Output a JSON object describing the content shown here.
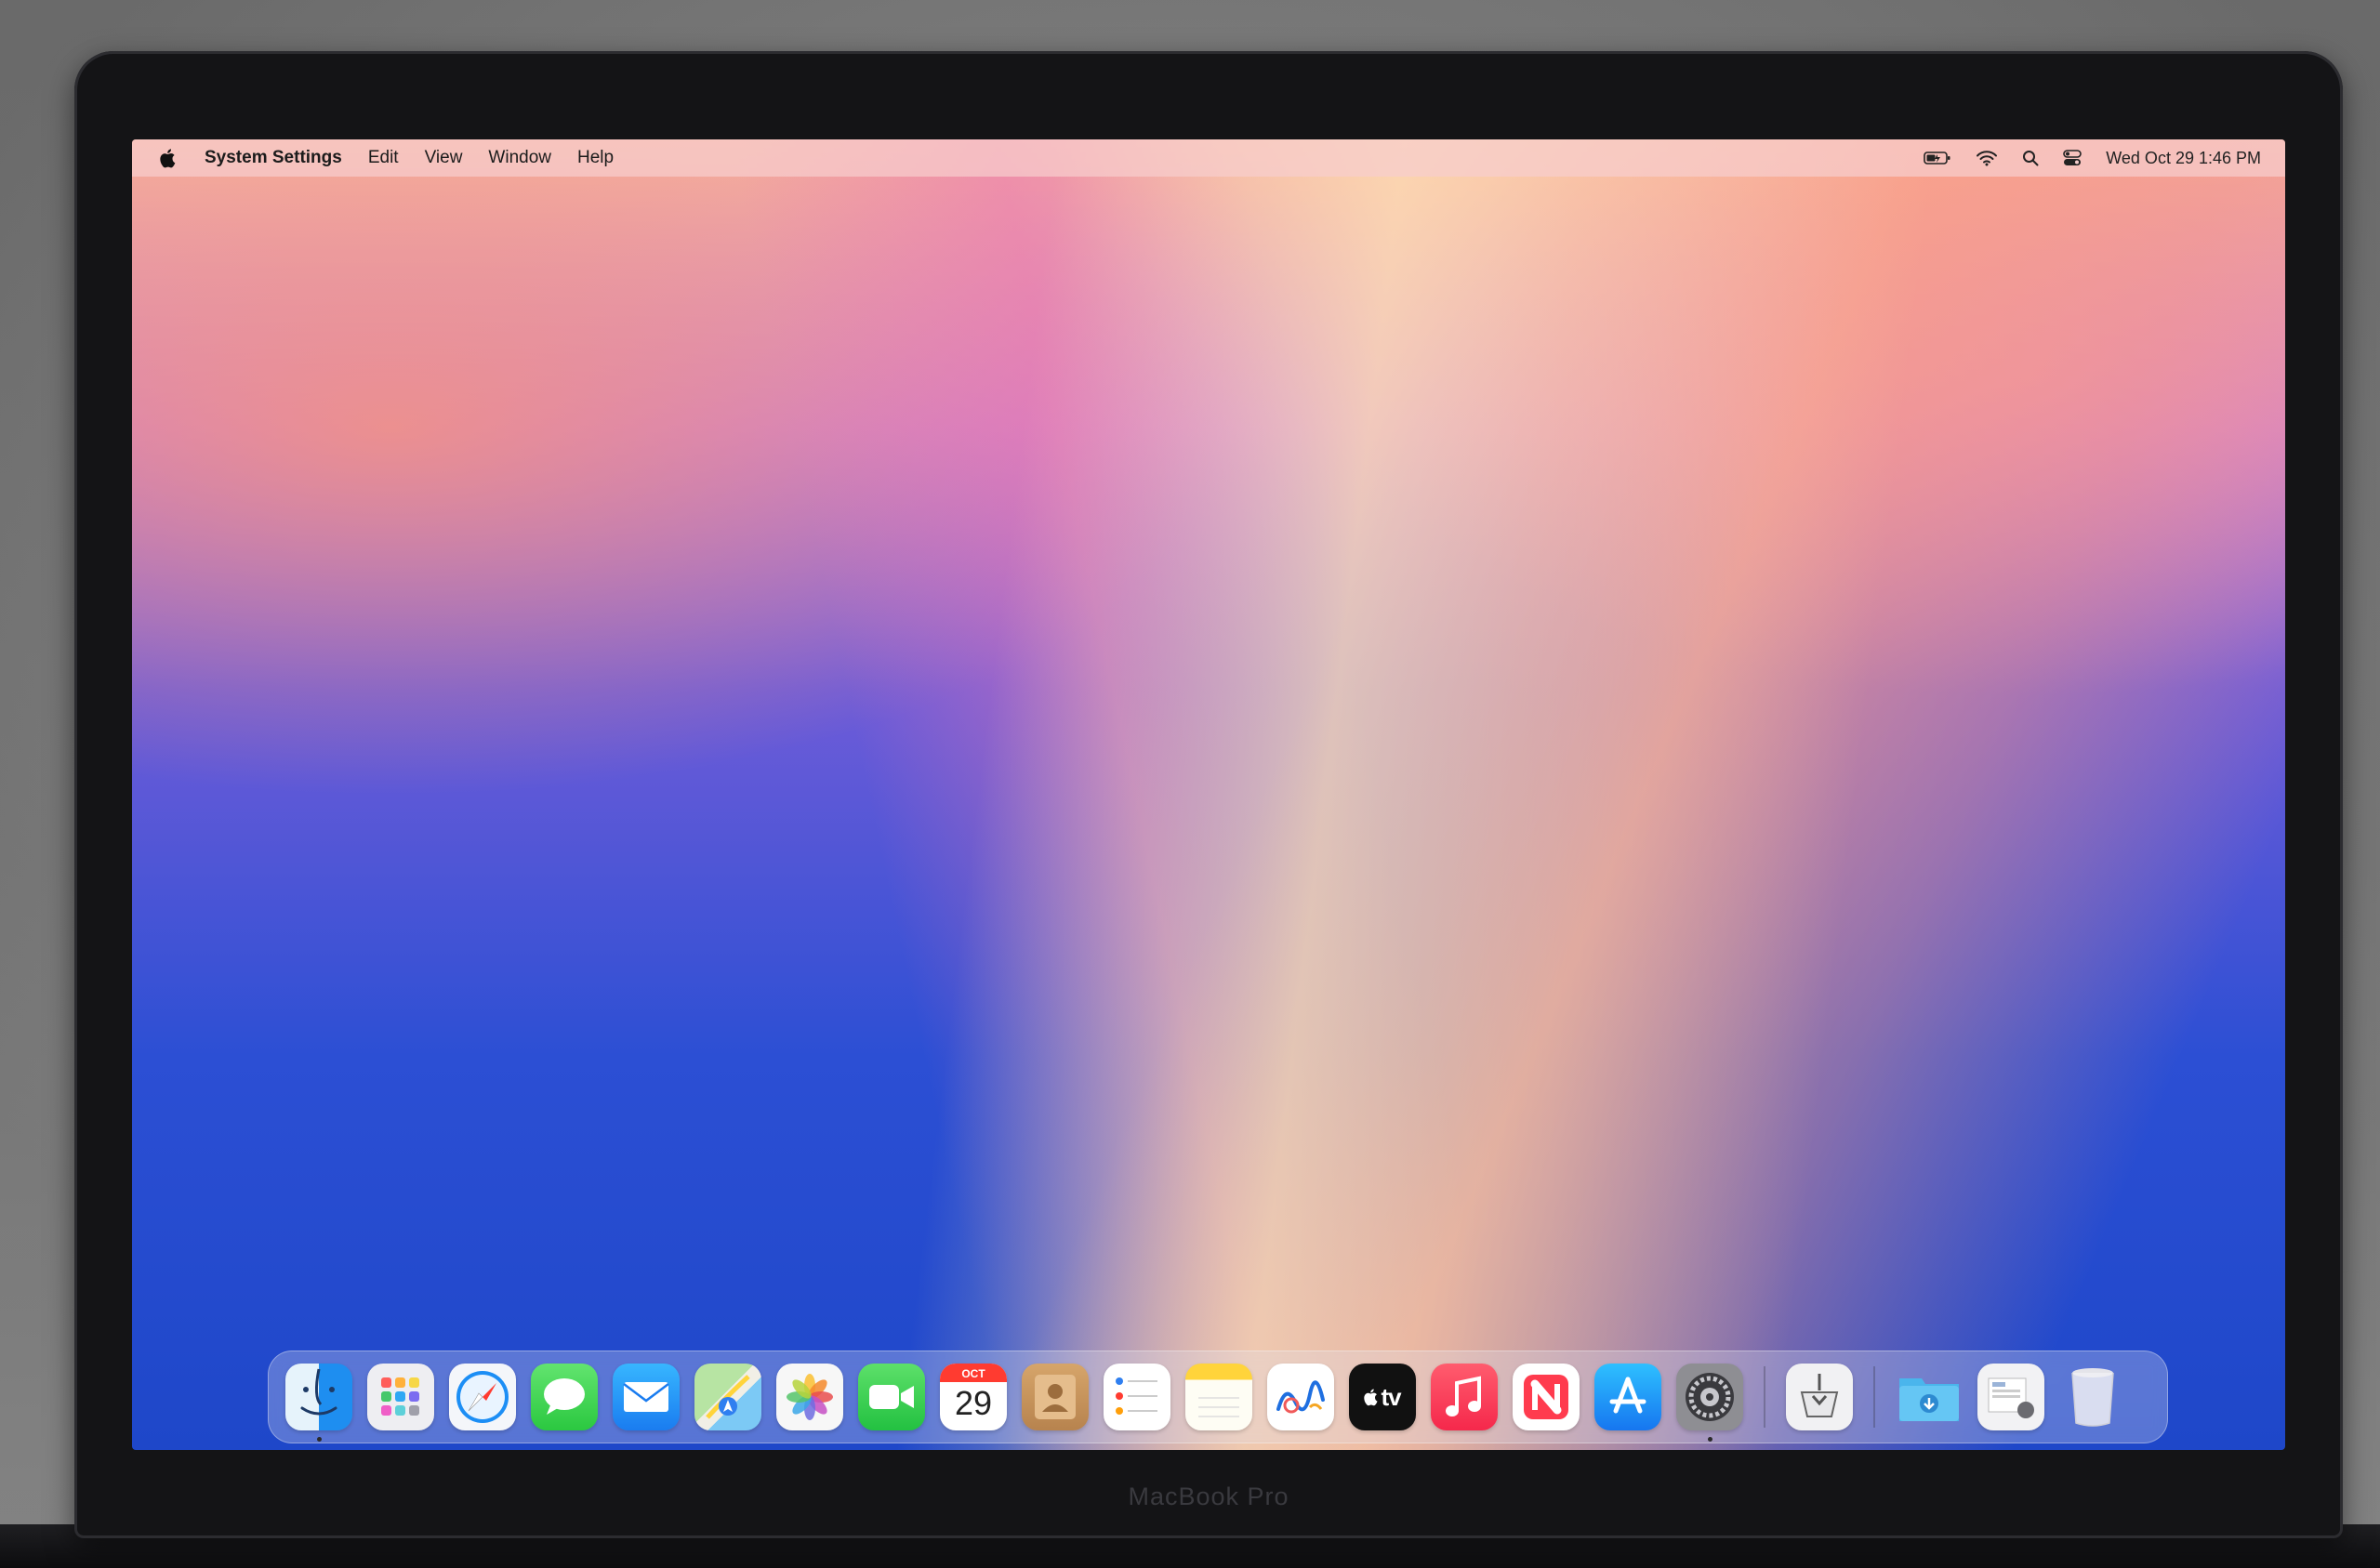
{
  "menubar": {
    "app_name": "System Settings",
    "menus": [
      "Edit",
      "View",
      "Window",
      "Help"
    ],
    "clock": "Wed Oct 29  1:46 PM",
    "status_icons": [
      "battery-icon",
      "wifi-icon",
      "spotlight-search-icon",
      "control-center-icon"
    ]
  },
  "dock": {
    "apps": [
      {
        "name": "Finder",
        "icon": "finder-icon",
        "running": true
      },
      {
        "name": "Launchpad",
        "icon": "launchpad-icon",
        "running": false
      },
      {
        "name": "Safari",
        "icon": "safari-icon",
        "running": false
      },
      {
        "name": "Messages",
        "icon": "messages-icon",
        "running": false
      },
      {
        "name": "Mail",
        "icon": "mail-icon",
        "running": false
      },
      {
        "name": "Maps",
        "icon": "maps-icon",
        "running": false
      },
      {
        "name": "Photos",
        "icon": "photos-icon",
        "running": false
      },
      {
        "name": "FaceTime",
        "icon": "facetime-icon",
        "running": false
      },
      {
        "name": "Calendar",
        "icon": "calendar-icon",
        "running": false,
        "month": "OCT",
        "day": "29"
      },
      {
        "name": "Contacts",
        "icon": "contacts-icon",
        "running": false
      },
      {
        "name": "Reminders",
        "icon": "reminders-icon",
        "running": false
      },
      {
        "name": "Notes",
        "icon": "notes-icon",
        "running": false
      },
      {
        "name": "Freeform",
        "icon": "freeform-icon",
        "running": false
      },
      {
        "name": "TV",
        "icon": "apple-tv-icon",
        "running": false,
        "label": "tv"
      },
      {
        "name": "Music",
        "icon": "music-icon",
        "running": false
      },
      {
        "name": "News",
        "icon": "news-icon",
        "running": false
      },
      {
        "name": "App Store",
        "icon": "app-store-icon",
        "running": false
      },
      {
        "name": "System Settings",
        "icon": "system-settings-icon",
        "running": true
      }
    ],
    "extras": [
      {
        "name": "Installer",
        "icon": "installer-icon"
      },
      {
        "name": "Downloads",
        "icon": "downloads-folder-icon"
      },
      {
        "name": "Recent Items",
        "icon": "recent-items-stack-icon"
      },
      {
        "name": "Trash",
        "icon": "trash-icon"
      }
    ]
  },
  "hardware": {
    "model_label": "MacBook Pro"
  }
}
